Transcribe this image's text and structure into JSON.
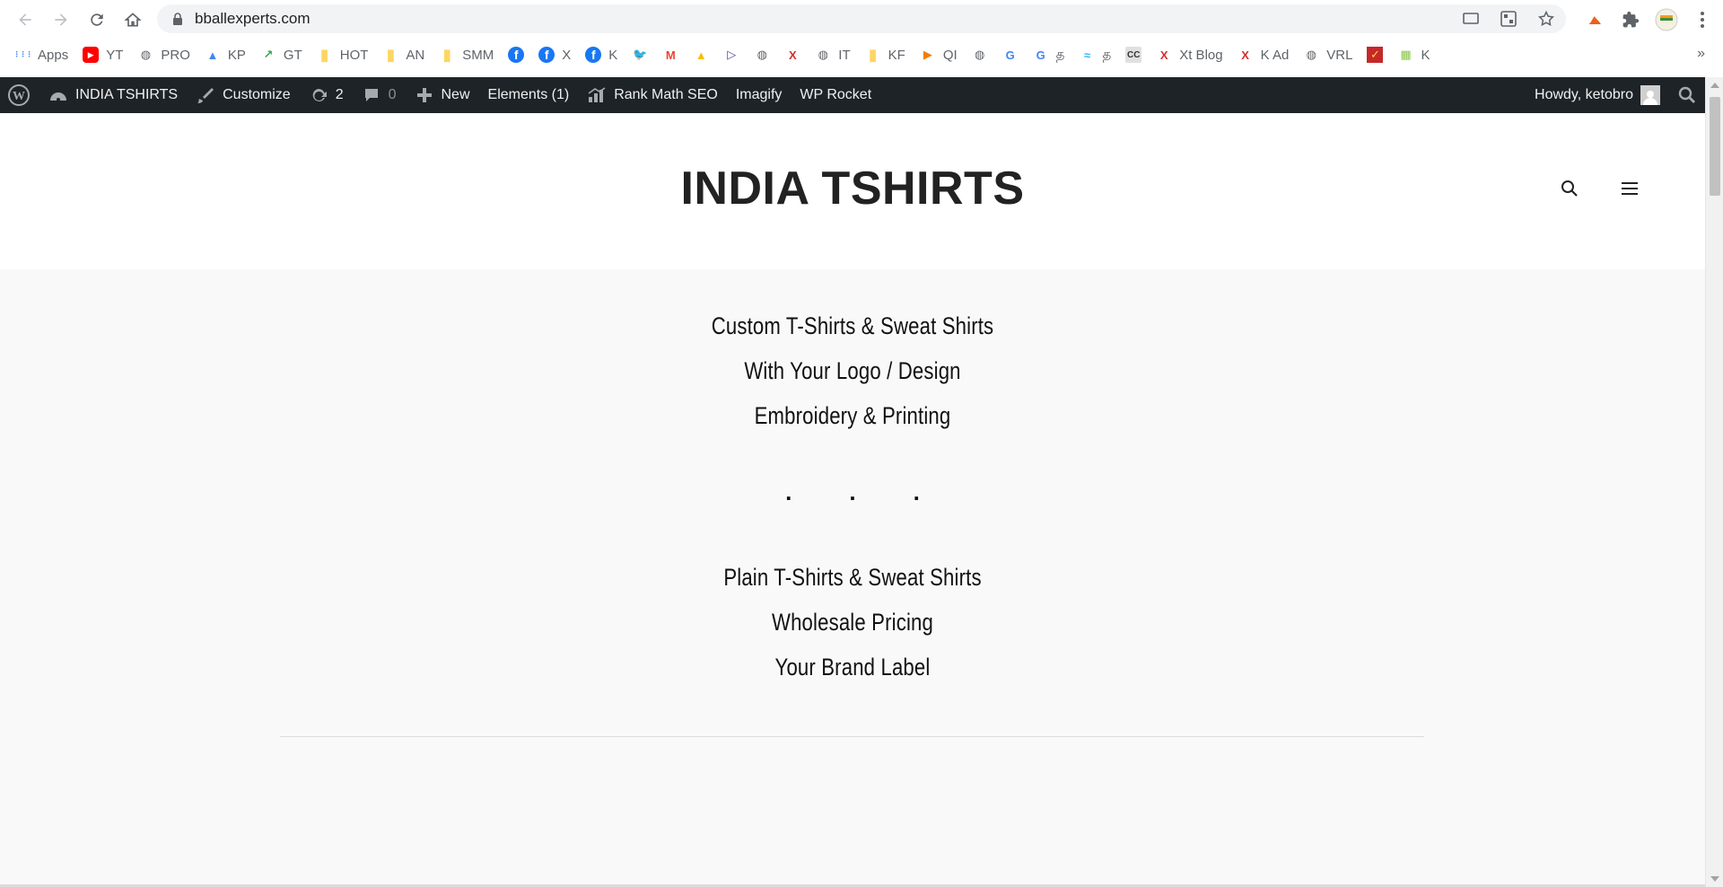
{
  "browser": {
    "url": "bballexperts.com",
    "bookmarks": [
      {
        "label": "Apps",
        "icon": "apps-grid-icon",
        "color": "#4285f4"
      },
      {
        "label": "YT",
        "icon": "youtube-icon",
        "color": "#ff0000"
      },
      {
        "label": "PRO",
        "icon": "globe-icon",
        "color": "#5f6368"
      },
      {
        "label": "KP",
        "icon": "google-ads-icon",
        "color": "#4285f4"
      },
      {
        "label": "GT",
        "icon": "trends-icon",
        "color": "#34a853"
      },
      {
        "label": "HOT",
        "icon": "folder-icon",
        "color": "#fdd663"
      },
      {
        "label": "AN",
        "icon": "folder-icon",
        "color": "#fdd663"
      },
      {
        "label": "SMM",
        "icon": "folder-icon",
        "color": "#fdd663"
      },
      {
        "label": "",
        "icon": "facebook-icon",
        "color": "#1877f2"
      },
      {
        "label": "X",
        "icon": "facebook-icon",
        "color": "#1877f2"
      },
      {
        "label": "K",
        "icon": "facebook-icon",
        "color": "#1877f2"
      },
      {
        "label": "",
        "icon": "twitter-icon",
        "color": "#1da1f2"
      },
      {
        "label": "",
        "icon": "gmail-icon",
        "color": "#ea4335"
      },
      {
        "label": "",
        "icon": "google-ads-icon",
        "color": "#fbbc04"
      },
      {
        "label": "",
        "icon": "play-icon",
        "color": "#5a3e9e"
      },
      {
        "label": "",
        "icon": "globe-icon",
        "color": "#5f6368"
      },
      {
        "label": "",
        "icon": "x-logo-icon",
        "color": "#d32f2f"
      },
      {
        "label": "IT",
        "icon": "globe-icon",
        "color": "#5f6368"
      },
      {
        "label": "KF",
        "icon": "folder-icon",
        "color": "#fdd663"
      },
      {
        "label": "QI",
        "icon": "play-triangle-icon",
        "color": "#f57c00"
      },
      {
        "label": "",
        "icon": "globe-icon",
        "color": "#5f6368"
      },
      {
        "label": "",
        "icon": "google-icon",
        "color": "#4285f4"
      },
      {
        "label": "த",
        "icon": "google-icon",
        "color": "#4285f4"
      },
      {
        "label": "த",
        "icon": "wave-icon",
        "color": "#29b6f6"
      },
      {
        "label": "",
        "icon": "cc-icon",
        "color": "#333333"
      },
      {
        "label": "Xt Blog",
        "icon": "x-logo-icon",
        "color": "#d32f2f"
      },
      {
        "label": "K Ad",
        "icon": "x-logo-icon",
        "color": "#d32f2f"
      },
      {
        "label": "VRL",
        "icon": "globe-icon",
        "color": "#5f6368"
      },
      {
        "label": "",
        "icon": "check-badge-icon",
        "color": "#c62828"
      },
      {
        "label": "K",
        "icon": "image-icon",
        "color": "#8bc34a"
      }
    ],
    "more_label": "»"
  },
  "adminbar": {
    "site_name": "INDIA TSHIRTS",
    "customize": "Customize",
    "updates_count": "2",
    "comments_count": "0",
    "new_label": "New",
    "elements_label": "Elements (1)",
    "rankmath_label": "Rank Math SEO",
    "imagify_label": "Imagify",
    "wprocket_label": "WP Rocket",
    "howdy": "Howdy, ketobro"
  },
  "site": {
    "title": "INDIA TSHIRTS",
    "lines_group1": [
      "Custom T-Shirts & Sweat Shirts",
      "With Your Logo / Design",
      "Embroidery & Printing"
    ],
    "dots": [
      ".",
      ".",
      "."
    ],
    "lines_group2": [
      "Plain T-Shirts & Sweat Shirts",
      "Wholesale Pricing",
      "Your Brand Label"
    ]
  }
}
